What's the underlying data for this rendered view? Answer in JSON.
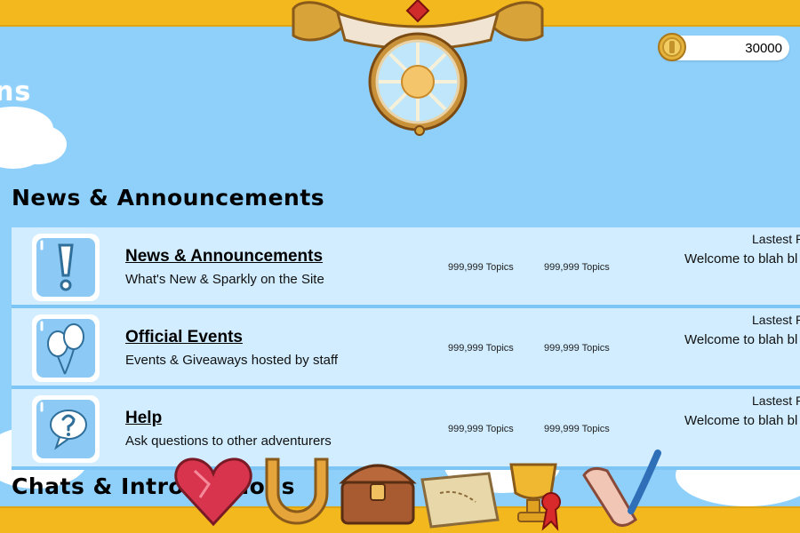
{
  "header": {
    "partial_title": "ns",
    "coins": {
      "value": "30000",
      "icon": "coin-icon"
    }
  },
  "sections": [
    {
      "heading": "News & Announcements",
      "rows": [
        {
          "icon": "exclamation-icon",
          "title": "News & Announcements",
          "description": "What's New & Sparkly on the Site",
          "topics_a": "999,999 Topics",
          "topics_b": "999,999 Topics",
          "latest_label": "Lastest P",
          "latest_text": "Welcome to blah bl"
        },
        {
          "icon": "balloons-icon",
          "title": "Official Events",
          "description": "Events & Giveaways hosted by staff",
          "topics_a": "999,999 Topics",
          "topics_b": "999,999 Topics",
          "latest_label": "Lastest P",
          "latest_text": "Welcome to blah bl"
        },
        {
          "icon": "question-bubble-icon",
          "title": "Help",
          "description": "Ask questions to other adventurers",
          "topics_a": "999,999 Topics",
          "topics_b": "999,999 Topics",
          "latest_label": "Lastest P",
          "latest_text": "Welcome to blah bl"
        }
      ]
    },
    {
      "heading": "Chats & Introductions"
    }
  ],
  "item_bar": [
    "heart-gem-icon",
    "horseshoe-icon",
    "treasure-chest-icon",
    "treasure-map-icon",
    "trophy-icon",
    "scroll-quill-icon"
  ],
  "colors": {
    "sky": "#8fd0fb",
    "row_bg": "#d1edff",
    "bar_gold": "#f2b81e",
    "icon_tile": "#8ccaf5"
  }
}
